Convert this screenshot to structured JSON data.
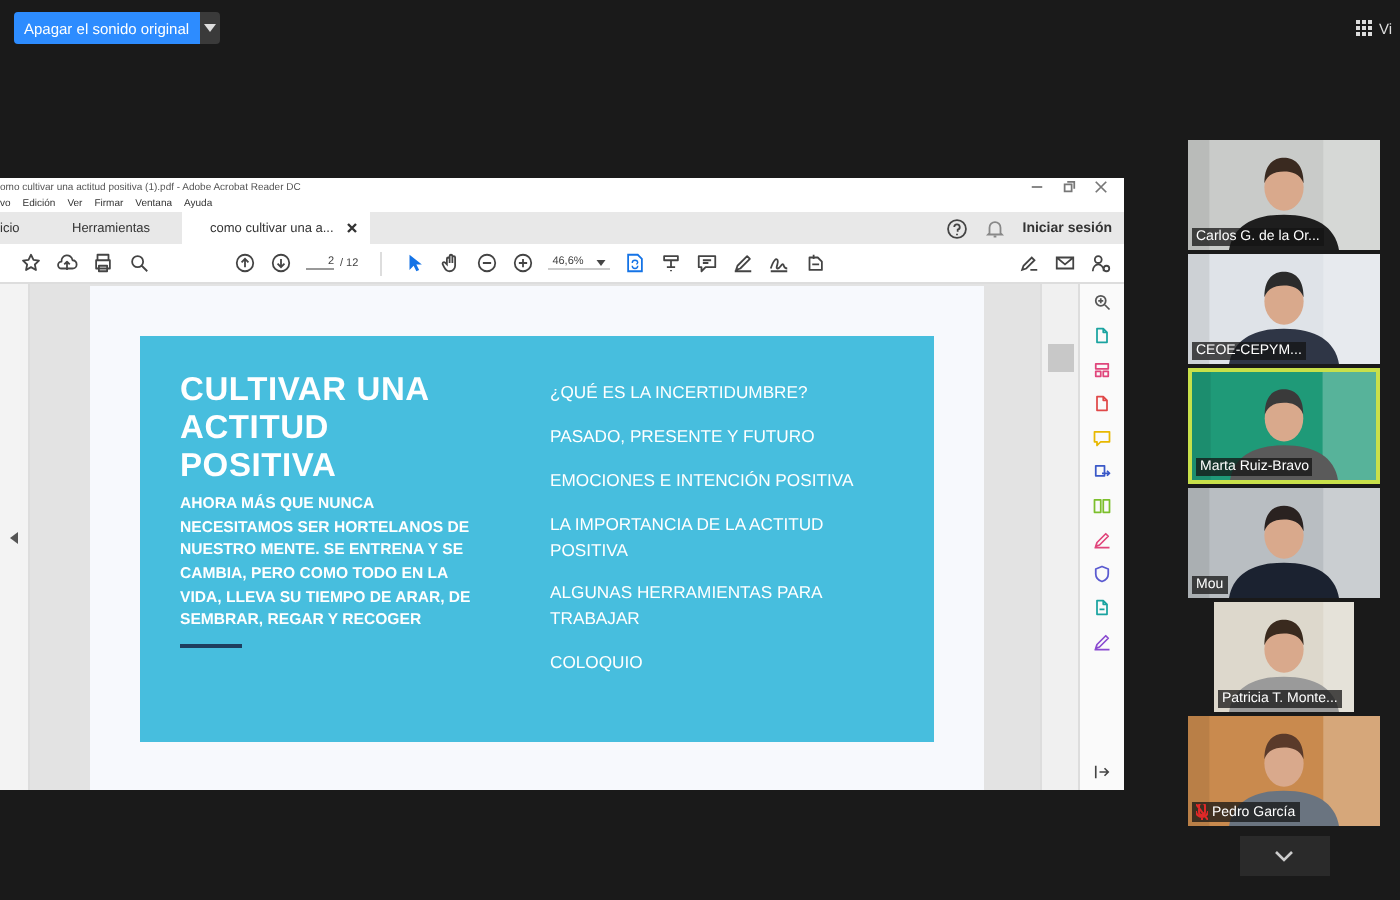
{
  "meeting": {
    "audio_button": "Apagar el sonido original",
    "view_button": "Vi"
  },
  "acrobat": {
    "title": "omo cultivar una actitud positiva (1).pdf - Adobe Acrobat Reader DC",
    "menu": [
      "vo",
      "Edición",
      "Ver",
      "Firmar",
      "Ventana",
      "Ayuda"
    ],
    "tabs": [
      {
        "label": "icio",
        "selected": false
      },
      {
        "label": "Herramientas",
        "selected": false
      },
      {
        "label": "como cultivar una a...",
        "selected": true
      }
    ],
    "sign_in": "Iniciar sesión",
    "page_number": "2",
    "page_total": "/ 12",
    "zoom": "46,6%"
  },
  "slide": {
    "title": "CULTIVAR UNA ACTITUD POSITIVA",
    "body": "AHORA MÁS QUE NUNCA NECESITAMOS SER HORTELANOS DE NUESTRO MENTE. SE ENTRENA Y SE CAMBIA, PERO COMO TODO EN LA VIDA, LLEVA SU TIEMPO DE ARAR, DE SEMBRAR, REGAR Y RECOGER",
    "topics": [
      "¿QUÉ ES LA INCERTIDUMBRE?",
      "PASADO, PRESENTE Y FUTURO",
      "EMOCIONES E INTENCIÓN POSITIVA",
      "LA IMPORTANCIA DE LA ACTITUD POSITIVA",
      "ALGUNAS HERRAMIENTAS PARA TRABAJAR",
      "COLOQUIO"
    ]
  },
  "participants": [
    {
      "name": "Carlos G. de la Or...",
      "speaking": false,
      "muted": false
    },
    {
      "name": "CEOE-CEPYM...",
      "speaking": false,
      "muted": false
    },
    {
      "name": "Marta Ruiz-Bravo",
      "speaking": true,
      "muted": false
    },
    {
      "name": "Mou",
      "speaking": false,
      "muted": false
    },
    {
      "name": "Patricia T. Monte...",
      "speaking": false,
      "muted": false
    },
    {
      "name": "Pedro García",
      "speaking": false,
      "muted": true
    }
  ]
}
